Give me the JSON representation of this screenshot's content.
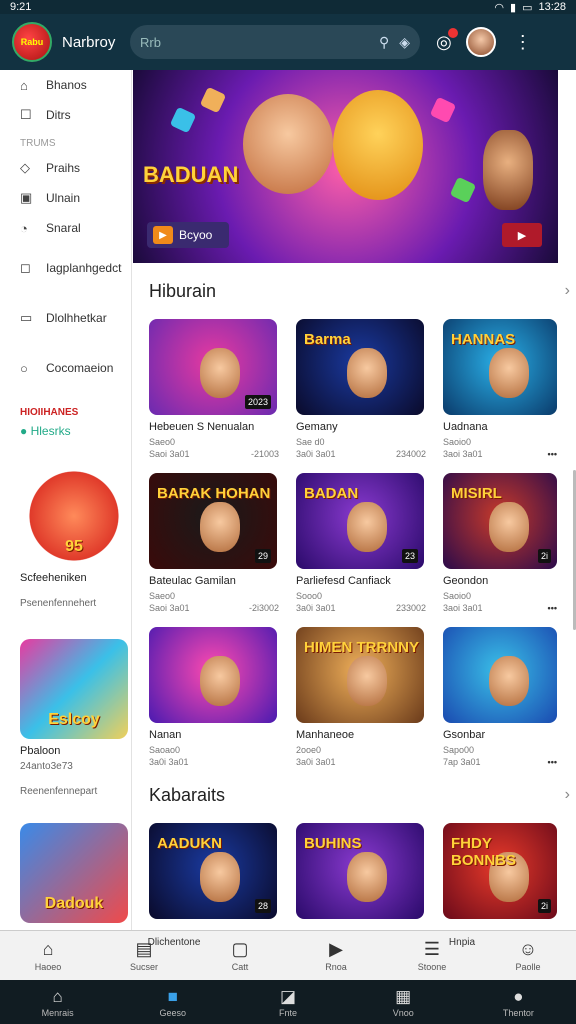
{
  "status": {
    "time": "9:21",
    "right_time": "13:28"
  },
  "appbar": {
    "logo_text": "Rabu",
    "brand": "Narbroy",
    "search_placeholder": "Rrb"
  },
  "sidebar": {
    "items_top": [
      {
        "icon": "home-outline-icon",
        "glyph": "⌂",
        "label": "Bhanos"
      },
      {
        "icon": "square-icon",
        "glyph": "☐",
        "label": "Ditrs"
      }
    ],
    "section_label": "TRUMS",
    "items_mid": [
      {
        "icon": "tag-icon",
        "glyph": "◇",
        "label": "Praihs"
      },
      {
        "icon": "briefcase-icon",
        "glyph": "▣",
        "label": "Ulnain"
      },
      {
        "icon": "clock-icon",
        "glyph": "◔",
        "label": "Snaral"
      },
      {
        "icon": "chat-icon",
        "glyph": "◻",
        "label": "Iagplanhgedct"
      },
      {
        "icon": "tv-icon",
        "glyph": "▭",
        "label": "Dlolhhetkar"
      },
      {
        "icon": "search-icon",
        "glyph": "○",
        "label": "Cocomaeion"
      }
    ],
    "red_label": "HIOIIHANES",
    "green_label": "Hlesrks",
    "cards": [
      {
        "title": "Scfeeheniken",
        "subtitle": "Psenenfennehert",
        "img_text": "95"
      },
      {
        "title": "Pbaloon",
        "meta": "24anto3e73",
        "subtitle": "Reenenfennepart",
        "img_text": "Eslcoy"
      },
      {
        "title": "",
        "subtitle": "",
        "img_text": "Dadouk"
      }
    ]
  },
  "hero": {
    "title": "BADUAN",
    "cta": "Bcyoo"
  },
  "sections": [
    {
      "title": "Hiburain",
      "games": [
        {
          "name": "Hebeuen S Nenualan",
          "meta": "Saeo0",
          "left": "Saoi 3a01",
          "right": "-21003",
          "img": "",
          "badge": "2023",
          "c1": "#e83aa0",
          "c2": "#6a2ab0"
        },
        {
          "name": "Gemany",
          "meta": "Sae d0",
          "left": "3a0i 3a01",
          "right": "234002",
          "img": "Barma",
          "badge": "",
          "c1": "#1a3aa0",
          "c2": "#0a0a2a"
        },
        {
          "name": "Uadnana",
          "meta": "Saoio0",
          "left": "3aoi 3a01",
          "right": "•••",
          "img": "HANNAS",
          "badge": "",
          "c1": "#2ab0e8",
          "c2": "#0a3a6a"
        },
        {
          "name": "Bateulac Gamilan",
          "meta": "Saeo0",
          "left": "Saoi 3a01",
          "right": "-2i3002",
          "img": "BARAK HOHAN",
          "badge": "29",
          "c1": "#1a1a1a",
          "c2": "#3a0a0a"
        },
        {
          "name": "Parliefesd Canfiack",
          "meta": "Sooo0",
          "left": "3a0i 3a01",
          "right": "233002",
          "img": "BADAN",
          "badge": "23",
          "c1": "#8a3ad0",
          "c2": "#2a0a6a"
        },
        {
          "name": "Geondon",
          "meta": "Saoio0",
          "left": "3aoi 3a01",
          "right": "•••",
          "img": "MISIRL",
          "badge": "2i",
          "c1": "#c83a2a",
          "c2": "#2a0a4a"
        },
        {
          "name": "Nanan",
          "meta": "Saoao0",
          "left": "3a0i 3a01",
          "right": "",
          "img": "",
          "badge": "",
          "c1": "#ff4ab0",
          "c2": "#4a1ab0"
        },
        {
          "name": "Manhaneoe",
          "meta": "2ooe0",
          "left": "3a0i 3a01",
          "right": "",
          "img": "HIMEN TRRNNY",
          "badge": "",
          "c1": "#f0b05a",
          "c2": "#6a3a1a"
        },
        {
          "name": "Gsonbar",
          "meta": "Sapo00",
          "left": "7ap 3a01",
          "right": "•••",
          "img": "",
          "badge": "",
          "c1": "#3ac0e8",
          "c2": "#1a4ab0"
        }
      ]
    },
    {
      "title": "Kabaraits",
      "games": [
        {
          "name": "",
          "meta": "",
          "left": "",
          "right": "",
          "img": "AADUKN",
          "badge": "28",
          "c1": "#1a3aa0",
          "c2": "#0a0a2a"
        },
        {
          "name": "",
          "meta": "",
          "left": "",
          "right": "",
          "img": "BUHINS",
          "badge": "",
          "c1": "#8a3ad0",
          "c2": "#2a0a6a"
        },
        {
          "name": "",
          "meta": "",
          "left": "",
          "right": "",
          "img": "FHDY BONNBS",
          "badge": "2i",
          "c1": "#e83a2a",
          "c2": "#6a0a1a"
        }
      ]
    }
  ],
  "bottom_nav": [
    {
      "icon": "home-icon",
      "glyph": "⌂",
      "label": "Haoeo"
    },
    {
      "icon": "book-icon",
      "glyph": "▤",
      "label": "Sucser",
      "extra": "Dlichentone"
    },
    {
      "icon": "image-icon",
      "glyph": "▢",
      "label": "Catt"
    },
    {
      "icon": "play-icon",
      "glyph": "▶",
      "label": "Rnoa"
    },
    {
      "icon": "list-icon",
      "glyph": "☰",
      "label": "Stoone",
      "extra": "Hnpia"
    },
    {
      "icon": "person-icon",
      "glyph": "☺",
      "label": "Paolle"
    }
  ],
  "system_nav": [
    {
      "icon": "home-filled-icon",
      "glyph": "⌂",
      "label": "Menrais"
    },
    {
      "icon": "store-icon",
      "glyph": "■",
      "label": "Geeso"
    },
    {
      "icon": "bookmark-icon",
      "glyph": "◪",
      "label": "Fnte"
    },
    {
      "icon": "gallery-icon",
      "glyph": "▦",
      "label": "Vnoo"
    },
    {
      "icon": "account-icon",
      "glyph": "●",
      "label": "Thentor"
    }
  ]
}
